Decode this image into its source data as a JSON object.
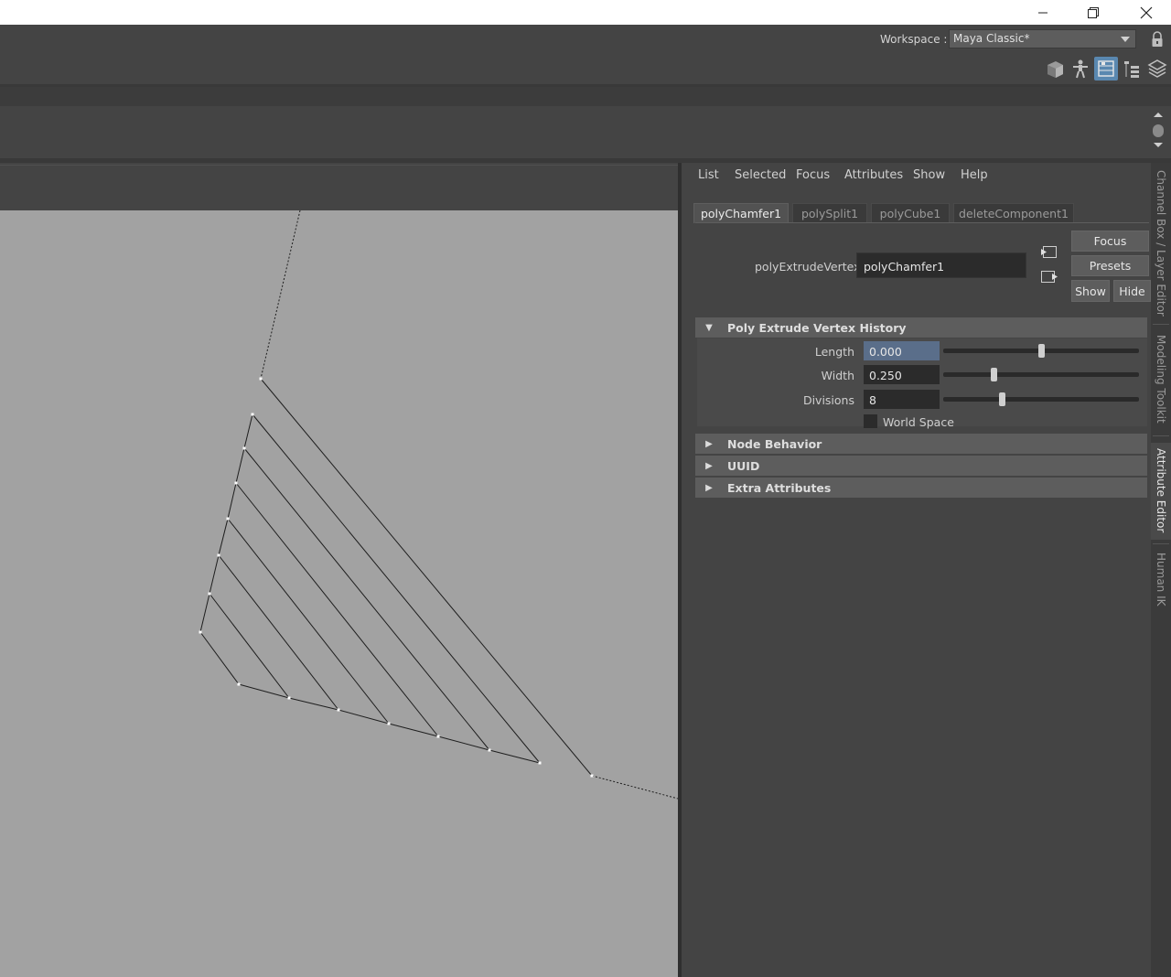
{
  "window": {
    "minimize_icon": "minimize-icon",
    "restore_icon": "restore-icon",
    "close_icon": "close-icon"
  },
  "workspace": {
    "label": "Workspace :",
    "value": "Maya Classic*"
  },
  "attribute_editor": {
    "menu": [
      "List",
      "Selected",
      "Focus",
      "Attributes",
      "Show",
      "Help"
    ],
    "tabs": [
      "polyChamfer1",
      "polySplit1",
      "polyCube1",
      "deleteComponent1"
    ],
    "node_label": "polyExtrudeVertex:",
    "node_value": "polyChamfer1",
    "buttons": {
      "focus": "Focus",
      "presets": "Presets",
      "show": "Show",
      "hide": "Hide"
    },
    "sections": {
      "history": "Poly Extrude Vertex History",
      "node_behavior": "Node Behavior",
      "uuid": "UUID",
      "extra": "Extra Attributes"
    },
    "attributes": {
      "length": {
        "label": "Length",
        "value": "0.000",
        "slider_fraction": 0.5
      },
      "width": {
        "label": "Width",
        "value": "0.250",
        "slider_fraction": 0.26
      },
      "divisions": {
        "label": "Divisions",
        "value": "8",
        "slider_fraction": 0.3
      },
      "world_space": {
        "label": "World Space",
        "checked": false
      }
    }
  },
  "side_tabs": [
    "Channel Box / Layer Editor",
    "Modeling Toolkit",
    "Attribute Editor",
    "Human IK"
  ],
  "colors": {
    "ui_bg": "#444444",
    "viewport_bg": "#a2a2a2",
    "highlight_field": "#5a6e8a",
    "active_icon_bg": "#5a88b0"
  }
}
